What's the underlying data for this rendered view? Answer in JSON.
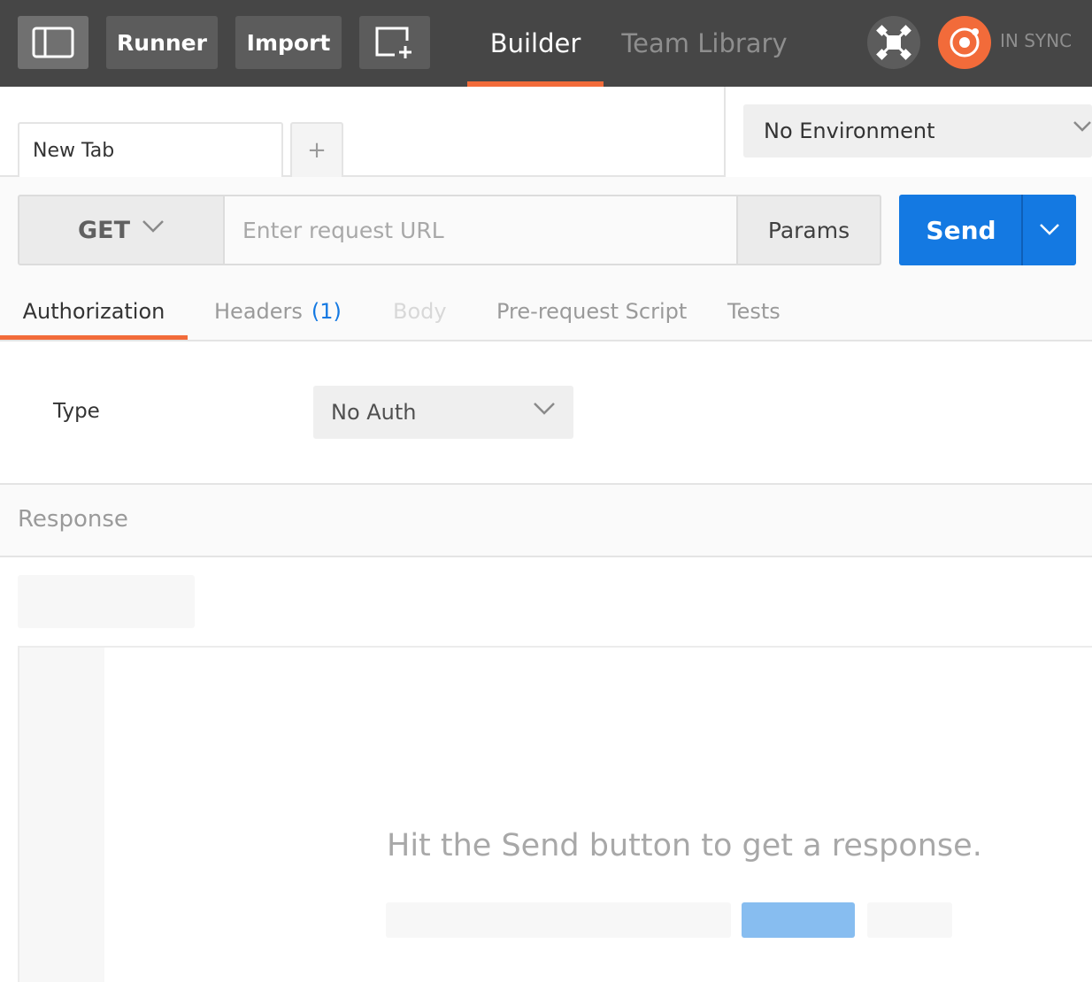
{
  "topbar": {
    "runner_label": "Runner",
    "import_label": "Import",
    "nav_builder": "Builder",
    "nav_team_library": "Team Library",
    "sync_status": "IN SYNC",
    "icons": {
      "sidebar_toggle": "sidebar-toggle-icon",
      "new_window": "new-window-icon",
      "interceptor": "interceptor-satellite-icon",
      "sync": "sync-status-icon"
    }
  },
  "tabs": {
    "active_tab_label": "New Tab",
    "add_tab_label": "+"
  },
  "environment": {
    "selected": "No Environment"
  },
  "request": {
    "method": "GET",
    "url_value": "",
    "url_placeholder": "Enter request URL",
    "params_label": "Params",
    "send_label": "Send"
  },
  "section_tabs": {
    "authorization": "Authorization",
    "headers": "Headers",
    "headers_count": "(1)",
    "body": "Body",
    "pre_request_script": "Pre-request Script",
    "tests": "Tests"
  },
  "auth": {
    "type_label": "Type",
    "type_value": "No Auth"
  },
  "response": {
    "title": "Response",
    "empty_hint": "Hit the Send button to get a response."
  },
  "colors": {
    "accent_orange": "#f26b3a",
    "send_blue": "#1479e2",
    "topbar_bg": "#464646"
  }
}
